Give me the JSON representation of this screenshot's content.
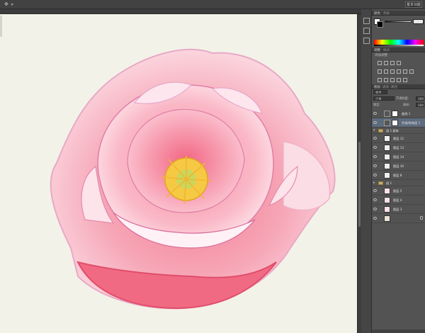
{
  "toolbar": {
    "workspace_label": "基本功能"
  },
  "colors": {
    "canvas_bg": "#f3f2e8",
    "ui_dark": "#535353",
    "selected_layer": "#5d6b7d"
  },
  "panels": {
    "color_tabs": [
      "颜色",
      "色板"
    ],
    "adjust_tabs": [
      "调整",
      "样式"
    ],
    "adjust_title": "添加调整",
    "layer_tabs": [
      "图层",
      "通道",
      "路径"
    ],
    "kind_label": "类型",
    "blend_mode": "正常",
    "opacity_label": "不透明度:",
    "opacity_value": "100%",
    "lock_label": "锁定:",
    "fill_label": "填充:",
    "fill_value": "100%"
  },
  "layers": [
    {
      "name": "曲线 1",
      "type": "adjustment",
      "selected": false
    },
    {
      "name": "色相/饱和度 1",
      "type": "adjustment",
      "selected": true
    },
    {
      "name": "组 1 副本",
      "type": "group",
      "selected": false
    },
    {
      "name": "图层 12",
      "type": "pixel",
      "selected": false
    },
    {
      "name": "图层 13",
      "type": "pixel",
      "selected": false
    },
    {
      "name": "图层 14",
      "type": "pixel",
      "selected": false
    },
    {
      "name": "图层 10",
      "type": "pixel",
      "selected": false
    },
    {
      "name": "图层 8",
      "type": "pixel",
      "selected": false
    },
    {
      "name": "组 1",
      "type": "group",
      "selected": false
    },
    {
      "name": "图层 5",
      "type": "pixel",
      "selected": false
    },
    {
      "name": "图层 4",
      "type": "pixel",
      "selected": false
    },
    {
      "name": "图层 3",
      "type": "pixel",
      "selected": false
    },
    {
      "name": "",
      "type": "background",
      "selected": false
    }
  ]
}
